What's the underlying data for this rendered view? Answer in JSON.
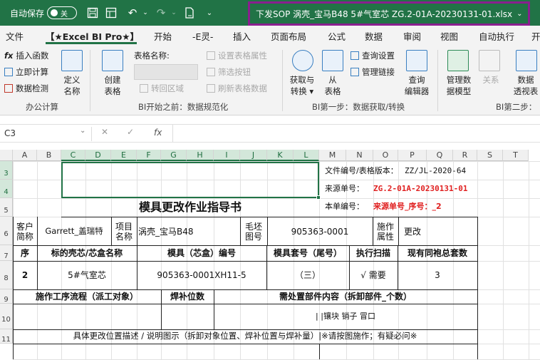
{
  "titlebar": {
    "autosave_label": "自动保存",
    "autosave_state": "关",
    "document_name": "下发SOP  涡壳_宝马B48  5#气室芯  ZG.2-01A-20230131-01.xlsx",
    "icons": [
      "save-icon",
      "undo-icon",
      "redo-icon",
      "document-icon",
      "more-icon",
      "chevron-down-icon"
    ]
  },
  "ribbon_tabs": [
    "文件",
    "【★Excel BI Pro★】",
    "开始",
    "-E灵-",
    "插入",
    "页面布局",
    "公式",
    "数据",
    "审阅",
    "视图",
    "自动执行",
    "开"
  ],
  "ribbon": {
    "g1": {
      "items": [
        "插入函数",
        "立即计算",
        "数据检测"
      ],
      "big": "定义\n名称",
      "label": "办公计算"
    },
    "g2": {
      "big": "创建\n表格",
      "name_label": "表格名称:",
      "items": [
        "设置表格属性",
        "筛选按钮",
        "转回区域",
        "刷新表格数据"
      ],
      "label": "BI开始之前：数据规范化"
    },
    "g3": {
      "big": [
        "获取与\n转换 ▾",
        "从\n表格",
        "查询\n编辑器"
      ],
      "items": [
        "查询设置",
        "管理链接"
      ],
      "label": "BI第一步：数据获取/转换"
    },
    "g4": {
      "big": [
        "管理数\n据模型",
        "关系",
        "数据\n透视表"
      ],
      "label": "BI第二步："
    }
  },
  "formula_bar": {
    "name_box": "C3",
    "fx": "fx",
    "value": ""
  },
  "columns": [
    "A",
    "B",
    "C",
    "D",
    "E",
    "F",
    "G",
    "H",
    "I",
    "J",
    "K",
    "L",
    "M",
    "N",
    "O",
    "P",
    "Q",
    "R",
    "S",
    "T"
  ],
  "rows": [
    "3",
    "4",
    "5",
    "6",
    "7",
    "8",
    "9",
    "10",
    "11"
  ],
  "sheet": {
    "file_no_label": "文件编号/表格版本：",
    "file_no_value": "ZZ/JL-2020-64",
    "source_label": "来源单号：",
    "source_value": "ZG.2-01A-20230131-01",
    "this_no_label": "本单编号：",
    "this_no_value": "来源单号_序号：_2",
    "title": "模具更改作业指导书",
    "customer_label": "客户\n简称",
    "customer_value": "Garrett_盖瑞特",
    "project_label": "项目\n名称",
    "project_value": "涡壳_宝马B48",
    "blank_label": "毛坯\n图号",
    "blank_value": "905363-0001",
    "construct_label": "施作\n属性",
    "construct_value": "更改",
    "h_seq": "序",
    "h_shell": "标的壳芯/芯盒名称",
    "h_mold": "模具（芯盒）编号",
    "h_set": "模具套号（尾号）",
    "h_exec": "执行扫描",
    "h_total": "现有同袍总套数",
    "r_seq": "2",
    "r_shell": "5#气室芯",
    "r_mold": "905363-0001XH11-5",
    "r_set": "（三）",
    "r_exec": "√ 需要",
    "r_total": "3",
    "flow_label": "施作工序流程（派工对象）",
    "weld_label": "焊补位数",
    "parts_label": "需处置部件内容（拆卸部件_个数）",
    "parts_value": "| |镶块   销子   冒口",
    "desc_label": "具体更改位置描述 / 说明图示（拆卸对象位置、焊补位置与焊补量）|※请按图施作；有疑必问※"
  }
}
